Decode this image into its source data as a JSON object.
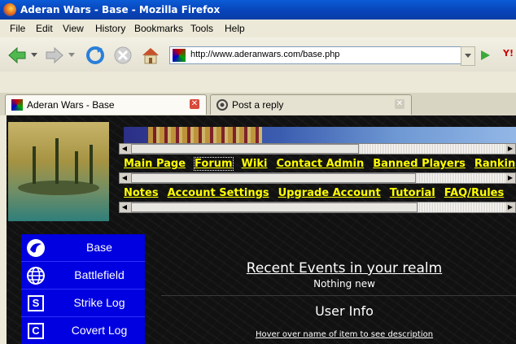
{
  "window": {
    "title": "Aderan Wars - Base - Mozilla Firefox"
  },
  "menu": [
    "File",
    "Edit",
    "View",
    "History",
    "Bookmarks",
    "Tools",
    "Help"
  ],
  "toolbar": {
    "url": "http://www.aderanwars.com/base.php",
    "search_engine_label": "Y!"
  },
  "tabs": [
    {
      "label": "Aderan Wars - Base",
      "active": true
    },
    {
      "label": "Post a reply",
      "active": false
    }
  ],
  "site": {
    "nav_row1": [
      "Main Page",
      "Forum",
      "Wiki",
      "Contact Admin",
      "Banned Players",
      "Rankin"
    ],
    "nav_row2": [
      "Notes",
      "Account Settings",
      "Upgrade Account",
      "Tutorial",
      "FAQ/Rules"
    ],
    "left_menu": [
      {
        "label": "Base",
        "icon": "globe-swirl-icon"
      },
      {
        "label": "Battlefield",
        "icon": "world-icon"
      },
      {
        "label": "Strike Log",
        "icon": "s-box-icon",
        "letter": "S"
      },
      {
        "label": "Covert Log",
        "icon": "c-box-icon",
        "letter": "C"
      }
    ],
    "recent_events_title": "Recent Events in your realm",
    "recent_events_text": "Nothing new",
    "user_info_title": "User Info",
    "hover_hint": "Hover over name of item to see description"
  },
  "colors": {
    "link": "#ffff00",
    "menu_bg": "#0000e0",
    "title_bar": "#0842b8"
  }
}
